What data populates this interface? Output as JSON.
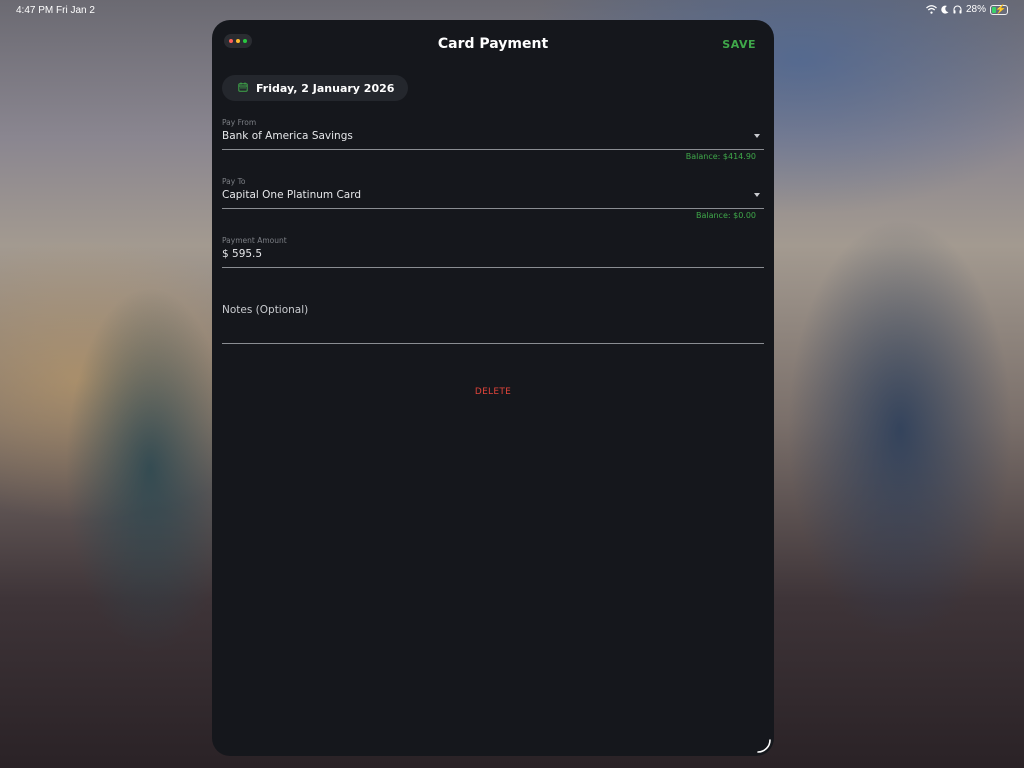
{
  "statusbar": {
    "time": "4:47 PM",
    "date": "Fri Jan 2",
    "battery_percent": "28%",
    "battery_level": 0.28,
    "icons": [
      "wifi-icon",
      "moon-icon",
      "headphones-icon",
      "battery-charging-icon"
    ]
  },
  "window": {
    "traffic_lights": [
      "close",
      "minimize",
      "zoom"
    ]
  },
  "header": {
    "title": "Card Payment",
    "save_label": "SAVE"
  },
  "date_chip": {
    "icon": "calendar-icon",
    "label": "Friday, 2 January 2026"
  },
  "form": {
    "pay_from": {
      "label": "Pay From",
      "value": "Bank of America Savings",
      "balance": "Balance: $414.90"
    },
    "pay_to": {
      "label": "Pay To",
      "value": "Capital One Platinum Card",
      "balance": "Balance: $0.00"
    },
    "amount": {
      "label": "Payment Amount",
      "value": "$ 595.5"
    },
    "notes": {
      "placeholder": "Notes (Optional)"
    }
  },
  "actions": {
    "delete_label": "DELETE"
  },
  "colors": {
    "accent_green": "#3fa84a",
    "danger_red": "#e0443a",
    "panel_bg": "#15171c"
  }
}
